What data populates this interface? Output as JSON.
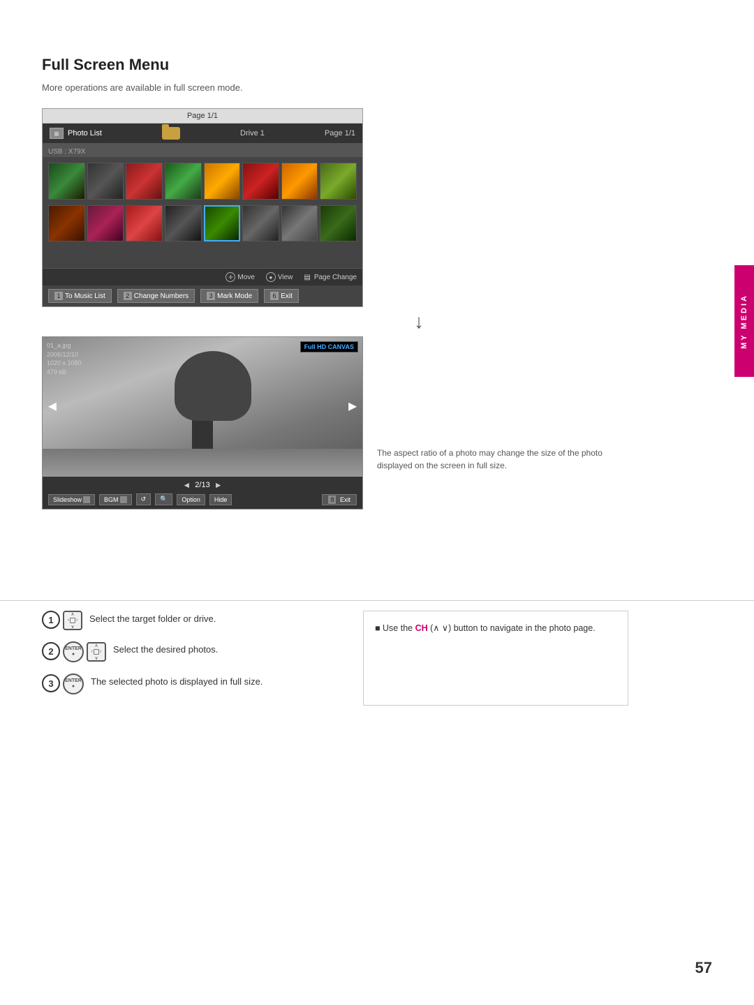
{
  "page": {
    "title": "Full Screen Menu",
    "subtitle": "More operations are available in full screen mode.",
    "page_number": "57"
  },
  "sidebar": {
    "label": "MY MEDIA"
  },
  "photo_list_screen": {
    "top_bar": "Page 1/1",
    "title": "Photo List",
    "usb_label": "USB : X79X",
    "drive_label": "Drive 1",
    "page_label": "Page 1/1",
    "nav_hints": [
      {
        "icon": "move-icon",
        "label": "Move"
      },
      {
        "icon": "view-icon",
        "label": "View"
      },
      {
        "icon": "page-change-icon",
        "label": "Page Change"
      }
    ],
    "buttons": [
      {
        "num": "1",
        "label": "To Music List"
      },
      {
        "num": "2",
        "label": "Change Numbers"
      },
      {
        "num": "3",
        "label": "Mark Mode"
      },
      {
        "num": "6",
        "label": "Exit"
      }
    ]
  },
  "fullscreen_viewer": {
    "file_info": {
      "filename": "01_a.jpg",
      "date": "2006/12/10",
      "resolution": "1020 x 1080",
      "size": "479 kB"
    },
    "badge": {
      "prefix": "Full HD",
      "suffix": "CANVAS"
    },
    "page_nav": "2/13",
    "controls": [
      {
        "label": "Slideshow",
        "id": "slideshow-btn"
      },
      {
        "label": "BGM",
        "id": "bgm-btn"
      },
      {
        "label": "↺",
        "id": "rotate-btn"
      },
      {
        "label": "🔍",
        "id": "zoom-btn"
      },
      {
        "label": "Option",
        "id": "option-btn"
      },
      {
        "label": "Hide",
        "id": "hide-btn"
      },
      {
        "label": "Exit",
        "id": "exit-btn",
        "num": "8"
      }
    ]
  },
  "right_note": "The aspect ratio of a photo may change the size of the photo displayed on the screen in full size.",
  "instructions": [
    {
      "step": "1",
      "text": "Select the target folder or drive.",
      "buttons": [
        "nav"
      ]
    },
    {
      "step": "2",
      "text": "Select the desired photos.",
      "buttons": [
        "enter",
        "nav"
      ]
    },
    {
      "step": "3",
      "text": "The selected photo is displayed in full size.",
      "buttons": [
        "enter"
      ]
    }
  ],
  "ch_note": {
    "bullet": "■",
    "text": "Use the ",
    "ch_label": "CH",
    "arrow_label": "(∧ ∨)",
    "text2": " button to navigate in the photo page."
  }
}
